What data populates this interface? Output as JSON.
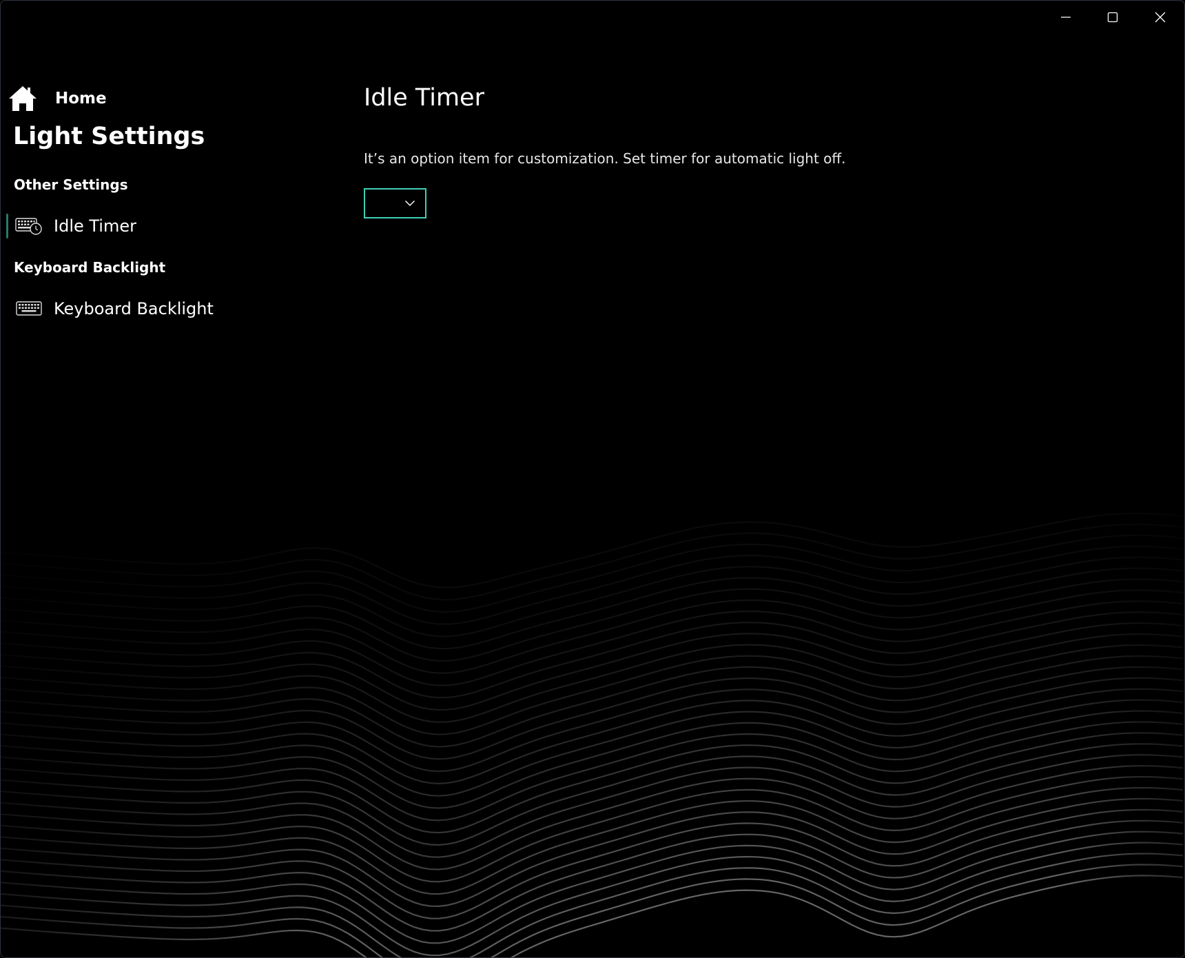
{
  "window": {
    "minimize_icon": "minimize-icon",
    "maximize_icon": "maximize-icon",
    "close_icon": "close-icon"
  },
  "sidebar": {
    "home": {
      "label": "Home",
      "icon": "home-icon"
    },
    "title": "Light Settings",
    "sections": [
      {
        "header": "Other Settings",
        "items": [
          {
            "label": "Idle Timer",
            "icon": "keyboard-clock-icon",
            "selected": true
          }
        ]
      },
      {
        "header": "Keyboard Backlight",
        "items": [
          {
            "label": "Keyboard Backlight",
            "icon": "keyboard-icon",
            "selected": false
          }
        ]
      }
    ]
  },
  "main": {
    "title": "Idle Timer",
    "description": "It’s an option item for customization. Set timer for automatic light off.",
    "timer_select": {
      "value": "",
      "icon": "chevron-down-icon"
    }
  },
  "colors": {
    "background": "#000000",
    "accent": "#3fd0b8",
    "selection_indicator": "#2a7a6a",
    "text": "#ffffff"
  }
}
